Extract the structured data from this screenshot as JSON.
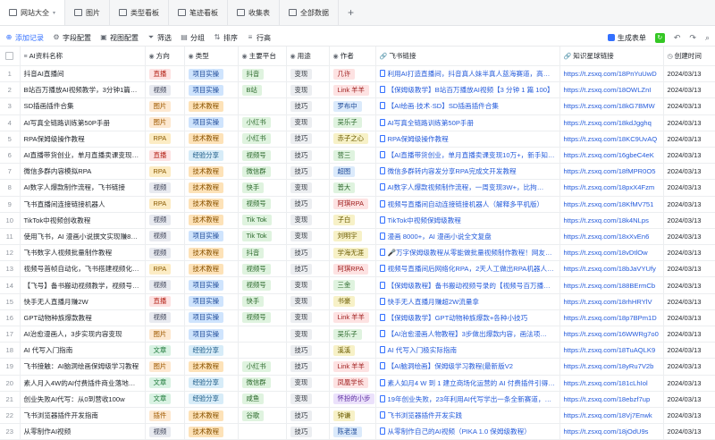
{
  "tabs": [
    {
      "label": "网站大全",
      "active": true
    },
    {
      "label": "图片"
    },
    {
      "label": "类型看板"
    },
    {
      "label": "笔迹看板"
    },
    {
      "label": "收集表"
    },
    {
      "label": "全部数据"
    }
  ],
  "tab_add": "+",
  "toolbar": {
    "add_label": "添加记录",
    "field_config": "字段配置",
    "view_config": "视图配置",
    "filter": "筛选",
    "group": "分组",
    "sort": "排序",
    "row_height": "行高",
    "generate_form": "生成表单"
  },
  "columns": [
    "AI资料名称",
    "方向",
    "类型",
    "主要平台",
    "用途",
    "作者",
    "飞书链接",
    "知识星球链接",
    "创建时间"
  ],
  "rows": [
    {
      "name": "抖音AI直播间",
      "dir": "直播",
      "dirc": "t-zhibo",
      "type": "项目实操",
      "typec": "t-project",
      "plat": "抖音",
      "use": "变现",
      "author": "几许",
      "ac": "p",
      "feishu": "利用AI打造直播间，抖音真人妹半真人蓝海赛道，高…",
      "url": "https://t.zsxq.com/18PnYuUwD",
      "time": "2024/03/13"
    },
    {
      "name": "B站百万播放AI视频教学，3分钟1篇100",
      "dir": "视频",
      "dirc": "t-shipin",
      "type": "项目实操",
      "typec": "t-project",
      "plat": "B站",
      "use": "变现",
      "author": "Link 羊羊",
      "ac": "p",
      "feishu": "【保姆级教学】B站百万播放AI视频【3 分钟 1 篇 100】",
      "url": "https://t.zsxq.com/18OWLZnI",
      "time": "2024/03/13"
    },
    {
      "name": "SD插画插件合集",
      "dir": "图片",
      "dirc": "t-tupian",
      "type": "技术教程",
      "typec": "t-tech",
      "plat": "",
      "use": "技巧",
      "author": "罗布中",
      "ac": "b",
      "feishu": "【AI绘画·技术·SD】SD插画插件合集",
      "url": "https://t.zsxq.com/18kG7BMW",
      "time": "2024/03/13"
    },
    {
      "name": "AI写真全链路训练第50P手册",
      "dir": "图片",
      "dirc": "t-tupian",
      "type": "项目实操",
      "typec": "t-project",
      "plat": "小红书",
      "use": "变现",
      "author": "吴乐子",
      "ac": "g",
      "feishu": "AI写真全链路训练第50P手册",
      "url": "https://t.zsxq.com/18kdJgghq",
      "time": "2024/03/13"
    },
    {
      "name": "RPA保姆级操作教程",
      "dir": "RPA",
      "dirc": "t-rpa",
      "type": "技术教程",
      "typec": "t-tech",
      "plat": "小红书",
      "use": "技巧",
      "author": "赤子之心",
      "ac": "",
      "feishu": "RPA保姆级操作教程",
      "url": "https://t.zsxq.com/18KC9UvAQ",
      "time": "2024/03/13"
    },
    {
      "name": "AI直播带货创业，单月直播卖课变现10万…",
      "dir": "直播",
      "dirc": "t-zhibo",
      "type": "经验分享",
      "typec": "t-exp",
      "plat": "视频号",
      "use": "技巧",
      "author": "营三",
      "ac": "g",
      "feishu": "【AI直播带货创业，单月直播卖课变现10万+，新手知识…",
      "url": "https://t.zsxq.com/16gbeC4eK",
      "time": "2024/03/13"
    },
    {
      "name": "微信多群内容模拟RPA",
      "dir": "RPA",
      "dirc": "t-rpa",
      "type": "技术教程",
      "typec": "t-tech",
      "plat": "微信群",
      "use": "技巧",
      "author": "超图",
      "ac": "b",
      "feishu": "微信多群转内容发分享RPA完成文开发教程",
      "url": "https://t.zsxq.com/18fMPR0O5",
      "time": "2024/03/13"
    },
    {
      "name": "AI数字人爆款制作流程，飞书链接",
      "dir": "视频",
      "dirc": "t-shipin",
      "type": "技术教程",
      "typec": "t-tech",
      "plat": "快手",
      "use": "变现",
      "author": "普大",
      "ac": "g",
      "feishu": "AI数字人爆款视频制作流程，一周变现3W+，比拘…",
      "url": "https://t.zsxq.com/18pxX4Fzm",
      "time": "2024/03/13"
    },
    {
      "name": "飞书直播间连接链接机器人",
      "dir": "RPA",
      "dirc": "t-rpa",
      "type": "技术教程",
      "typec": "t-tech",
      "plat": "视频号",
      "use": "技巧",
      "author": "阿琪RPA",
      "ac": "p",
      "feishu": "视频号直播间自动连接链接机器人（解释多平机版）",
      "url": "https://t.zsxq.com/18KfMV751",
      "time": "2024/03/13"
    },
    {
      "name": "TikTok中视频创收教程",
      "dir": "视频",
      "dirc": "t-shipin",
      "type": "技术教程",
      "typec": "t-tech",
      "plat": "Tik Tok",
      "use": "变现",
      "author": "子白",
      "ac": "",
      "feishu": "TikTok中视频保姆级教程",
      "url": "https://t.zsxq.com/18k4NLps",
      "time": "2024/03/13"
    },
    {
      "name": "使用飞书，AI 漫画小说撰文实现赚800…",
      "dir": "视频",
      "dirc": "t-shipin",
      "type": "项目实操",
      "typec": "t-project",
      "plat": "Tik Tok",
      "use": "变现",
      "author": "刘明宇",
      "ac": "",
      "feishu": "漫画 8000+，AI 漫画小说全文复盘",
      "url": "https://t.zsxq.com/18xXvEn6",
      "time": "2024/03/13"
    },
    {
      "name": "飞书数字人视频批量制作教程",
      "dir": "视频",
      "dirc": "t-shipin",
      "type": "技术教程",
      "typec": "t-tech",
      "plat": "抖音",
      "use": "技巧",
      "author": "学海无涯",
      "ac": "",
      "feishu": "🎤万字保姆级教程从零能做批量视频制作教程！网友推…",
      "url": "https://t.zsxq.com/18vDtlOw",
      "time": "2024/03/13"
    },
    {
      "name": "视频号首帧自动化，飞书搭建视频化RPA…",
      "dir": "RPA",
      "dirc": "t-rpa",
      "type": "技术教程",
      "typec": "t-tech",
      "plat": "视频号",
      "use": "技巧",
      "author": "阿琪RPA",
      "ac": "p",
      "feishu": "视频号直播间后网络化RPA，2天人工做出RPA机器人教程",
      "url": "https://t.zsxq.com/18bJaVYUfy",
      "time": "2024/03/13"
    },
    {
      "name": "【飞号】备书搬动视频教学，视频号百…",
      "dir": "视频",
      "dirc": "t-shipin",
      "type": "项目实操",
      "typec": "t-project",
      "plat": "视频号",
      "use": "变现",
      "author": "三金",
      "ac": "g",
      "feishu": "【保姆级教程】备书搬动视频号录的【视频号百万播放】",
      "url": "https://t.zsxq.com/188BErmCb",
      "time": "2024/03/13"
    },
    {
      "name": "快手无人直播月赚2W",
      "dir": "直播",
      "dirc": "t-zhibo",
      "type": "项目实操",
      "typec": "t-project",
      "plat": "快手",
      "use": "变现",
      "author": "书豪",
      "ac": "",
      "feishu": "快手无人直播月赚超2W流量拿",
      "url": "https://t.zsxq.com/18rhHRYlV",
      "time": "2024/03/13"
    },
    {
      "name": "GPT动物种族爆款教程",
      "dir": "视频",
      "dirc": "t-shipin",
      "type": "项目实操",
      "typec": "t-project",
      "plat": "视频号",
      "use": "变现",
      "author": "Link 羊羊",
      "ac": "p",
      "feishu": "【保姆级教学】GPT动物种族爆款+各种小技巧",
      "url": "https://t.zsxq.com/18p7BPm1D",
      "time": "2024/03/13"
    },
    {
      "name": "AI治愈漫画人，3步实现内容变现",
      "dir": "图片",
      "dirc": "t-tupian",
      "type": "项目实操",
      "typec": "t-project",
      "plat": "",
      "use": "变现",
      "author": "吴乐子",
      "ac": "g",
      "feishu": "【AI治愈漫画人物教程】3步做出爆款内容，画法项…",
      "url": "https://t.zsxq.com/16WWRg7o0",
      "time": "2024/03/13"
    },
    {
      "name": "AI 代写入门指南",
      "dir": "文章",
      "dirc": "t-wenzhang",
      "type": "经验分享",
      "typec": "t-exp",
      "plat": "",
      "use": "技巧",
      "author": "溪溪",
      "ac": "",
      "feishu": "AI 代写入门极实际指南",
      "url": "https://t.zsxq.com/18TuAQLK9",
      "time": "2024/03/13"
    },
    {
      "name": "飞书接触：AI脑洞绘画保姆级学习教程",
      "dir": "图片",
      "dirc": "t-tupian",
      "type": "技术教程",
      "typec": "t-tech",
      "plat": "小红书",
      "use": "技巧",
      "author": "Link 羊羊",
      "ac": "p",
      "feishu": "【AI脑洞绘画】保姆级学习教程(最新版V2",
      "url": "https://t.zsxq.com/18yRu7V2b",
      "time": "2024/03/13"
    },
    {
      "name": "素人月入4W的AI付费插件商业落地方法",
      "dir": "文章",
      "dirc": "t-wenzhang",
      "type": "经验分享",
      "typec": "t-exp",
      "plat": "微信群",
      "use": "变现",
      "author": "凤凰学长",
      "ac": "p",
      "feishu": "素人如月4 W 到 1 建立商场化运营的 AI 付费插件引得，月…",
      "url": "https://t.zsxq.com/181cLhIol",
      "time": "2024/03/13"
    },
    {
      "name": "创业失败AI代写：从0到营收100w",
      "dir": "文章",
      "dirc": "t-wenzhang",
      "type": "经验分享",
      "typec": "t-exp",
      "plat": "咸鱼",
      "use": "变现",
      "author": "怀扮的小步",
      "ac": "v",
      "feishu": "19年创业失败，23年利用AI代写学出一条全新赛道，从…",
      "url": "https://t.zsxq.com/18ebzf7up",
      "time": "2024/03/13"
    },
    {
      "name": "飞书浏览器插件开发指南",
      "dir": "插件",
      "dirc": "t-tupian",
      "type": "技术教程",
      "typec": "t-tech",
      "plat": "谷歌",
      "use": "技巧",
      "author": "钟谦",
      "ac": "",
      "feishu": "飞书浏览器插件开发实践",
      "url": "https://t.zsxq.com/18Vj7Enwk",
      "time": "2024/03/13"
    },
    {
      "name": "从零制作AI视频",
      "dir": "视频",
      "dirc": "t-shipin",
      "type": "技术教程",
      "typec": "t-tech",
      "plat": "",
      "use": "技巧",
      "author": "陈老湿",
      "ac": "b",
      "feishu": "从零制作自己的AI视频（PIKA 1.0 保姆级教程）",
      "url": "https://t.zsxq.com/18jOdU9s",
      "time": "2024/03/13"
    }
  ]
}
